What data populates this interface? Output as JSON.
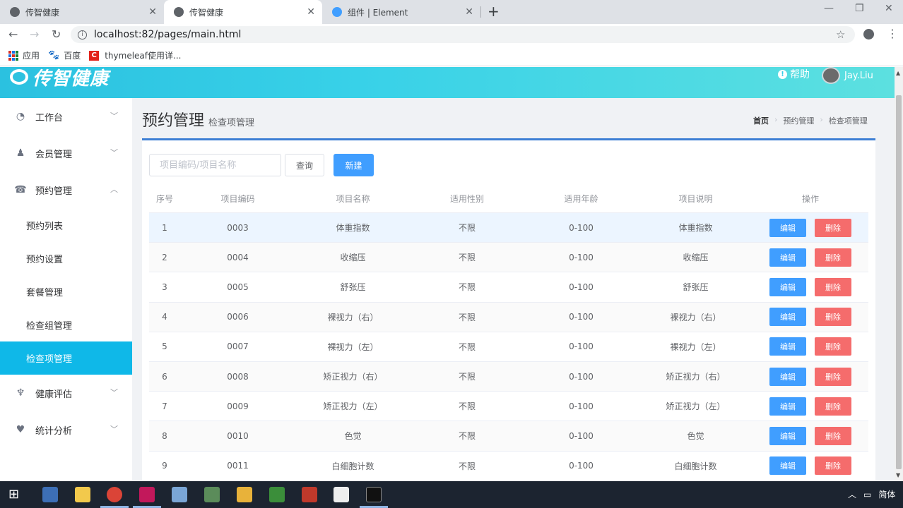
{
  "browser": {
    "tabs": [
      {
        "title": "传智健康",
        "active": false
      },
      {
        "title": "传智健康",
        "active": true
      },
      {
        "title": "组件 | Element",
        "active": false
      }
    ],
    "url": "localhost:82/pages/main.html",
    "bookmarks": [
      "应用",
      "百度",
      "thymeleaf使用详..."
    ]
  },
  "header": {
    "logo": "传智健康",
    "help": "帮助",
    "user": "Jay.Liu"
  },
  "sidebar": {
    "menus": [
      {
        "label": "工作台",
        "icon": "dashboard-icon"
      },
      {
        "label": "会员管理",
        "icon": "user-icon"
      },
      {
        "label": "预约管理",
        "icon": "phone-icon",
        "expanded": true
      },
      {
        "label": "健康评估",
        "icon": "stethoscope-icon"
      },
      {
        "label": "统计分析",
        "icon": "heartbeat-icon"
      }
    ],
    "sub_items": [
      "预约列表",
      "预约设置",
      "套餐管理",
      "检查组管理",
      "检查项管理"
    ],
    "active_sub": "检查项管理"
  },
  "page": {
    "title": "预约管理",
    "subtitle": "检查项管理",
    "breadcrumb": [
      "首页",
      "预约管理",
      "检查项管理"
    ]
  },
  "toolbar": {
    "search_placeholder": "项目编码/项目名称",
    "query_label": "查询",
    "new_label": "新建"
  },
  "table": {
    "headers": [
      "序号",
      "项目编码",
      "项目名称",
      "适用性别",
      "适用年龄",
      "项目说明",
      "操作"
    ],
    "edit_label": "编辑",
    "delete_label": "删除",
    "rows": [
      [
        "1",
        "0003",
        "体重指数",
        "不限",
        "0-100",
        "体重指数"
      ],
      [
        "2",
        "0004",
        "收缩压",
        "不限",
        "0-100",
        "收缩压"
      ],
      [
        "3",
        "0005",
        "舒张压",
        "不限",
        "0-100",
        "舒张压"
      ],
      [
        "4",
        "0006",
        "裸视力（右）",
        "不限",
        "0-100",
        "裸视力（右）"
      ],
      [
        "5",
        "0007",
        "裸视力（左）",
        "不限",
        "0-100",
        "裸视力（左）"
      ],
      [
        "6",
        "0008",
        "矫正视力（右）",
        "不限",
        "0-100",
        "矫正视力（右）"
      ],
      [
        "7",
        "0009",
        "矫正视力（左）",
        "不限",
        "0-100",
        "矫正视力（左）"
      ],
      [
        "8",
        "0010",
        "色觉",
        "不限",
        "0-100",
        "色觉"
      ],
      [
        "9",
        "0011",
        "白细胞计数",
        "不限",
        "0-100",
        "白细胞计数"
      ]
    ]
  },
  "taskbar": {
    "tray_lang": "简体"
  },
  "colors": {
    "primary": "#409eff",
    "danger": "#f56c6c",
    "active_menu": "#0fb8e8",
    "header_gradient_start": "#2bc1e0"
  }
}
